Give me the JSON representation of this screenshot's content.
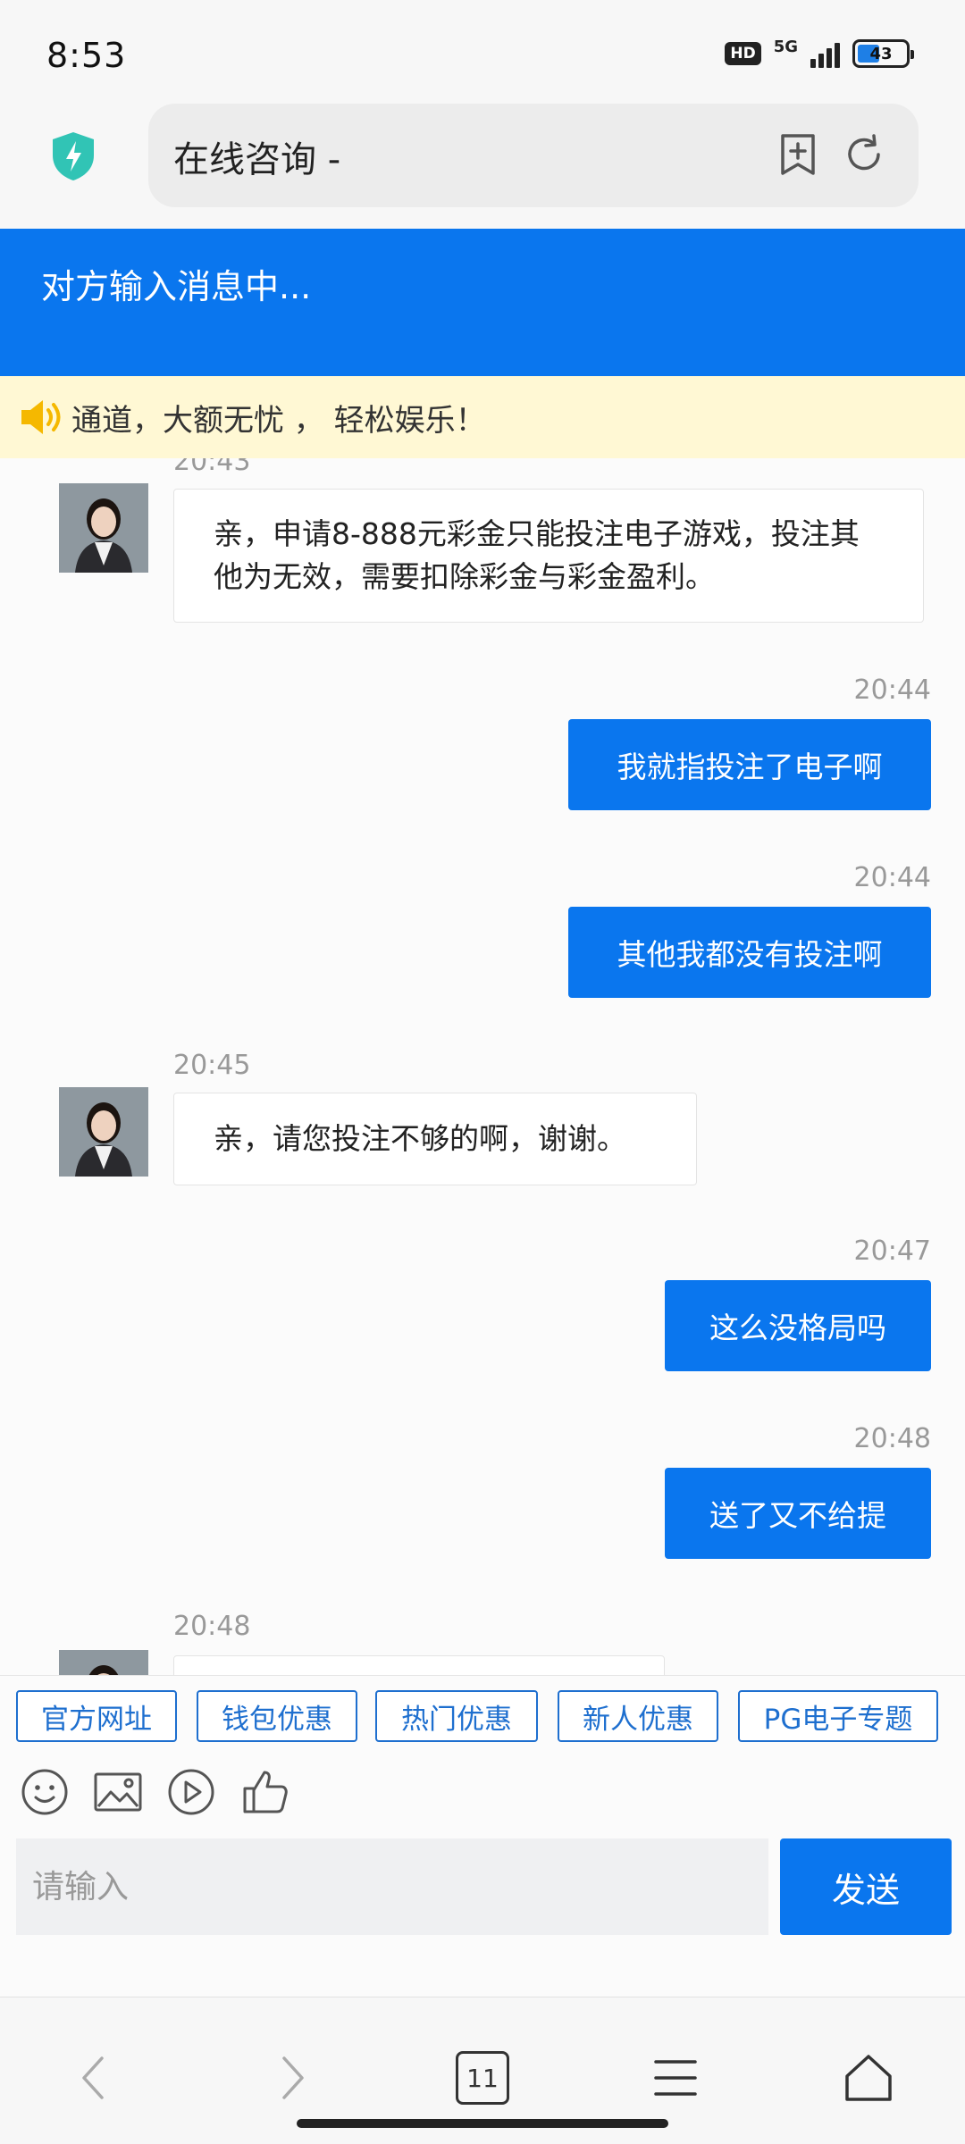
{
  "status_bar": {
    "time": "8:53",
    "hd": "HD",
    "network": "5G",
    "battery": "43"
  },
  "browser": {
    "url_title": "在线咨询 -",
    "tab_count": "11"
  },
  "chat": {
    "typing_status": "对方输入消息中...",
    "notice": "通道，大额无忧 ， 轻松娱乐！",
    "messages": [
      {
        "side": "left",
        "time": "20:43",
        "text": "亲，申请8-888元彩金只能投注电子游戏，投注其他为无效，需要扣除彩金与彩金盈利。"
      },
      {
        "side": "right",
        "time": "20:44",
        "text": "我就指投注了电子啊"
      },
      {
        "side": "right",
        "time": "20:44",
        "text": "其他我都没有投注啊"
      },
      {
        "side": "left",
        "time": "20:45",
        "text": "亲，请您投注不够的啊，谢谢。"
      },
      {
        "side": "right",
        "time": "20:47",
        "text": "这么没格局吗"
      },
      {
        "side": "right",
        "time": "20:48",
        "text": "送了又不给提"
      },
      {
        "side": "left",
        "time": "20:48",
        "text": ""
      }
    ]
  },
  "quick_replies": [
    "官方网址",
    "钱包优惠",
    "热门优惠",
    "新人优惠",
    "PG电子专题"
  ],
  "toolbar_icons": [
    "emoji-icon",
    "image-icon",
    "video-icon",
    "thumbs-up-icon"
  ],
  "input": {
    "placeholder": "请输入",
    "value": ""
  },
  "send_label": "发送",
  "colors": {
    "brand_blue": "#0a76ee",
    "notice_bg": "#fff8d4",
    "quick_border": "#1e6fcf"
  }
}
